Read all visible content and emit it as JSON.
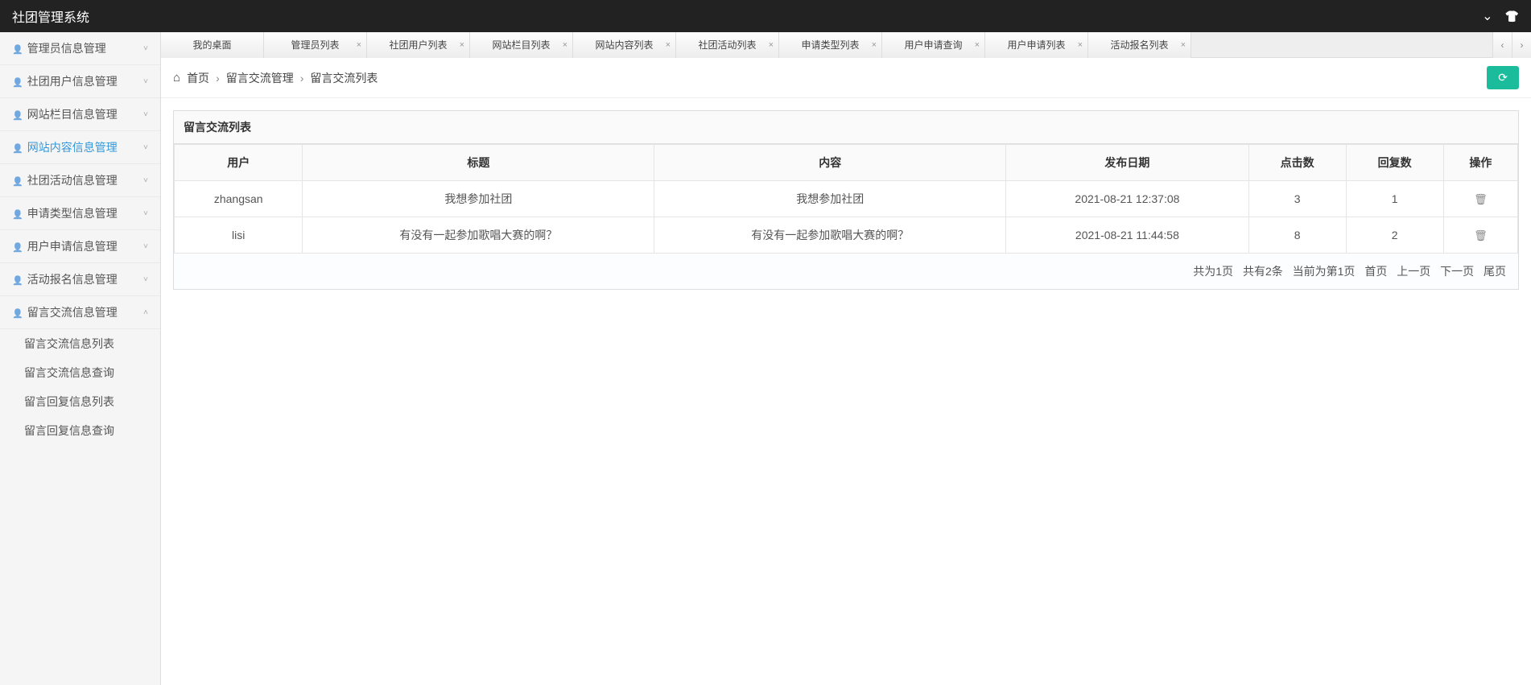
{
  "app_title": "社团管理系统",
  "sidebar": {
    "items": [
      {
        "label": "管理员信息管理",
        "expanded": false,
        "active": false
      },
      {
        "label": "社团用户信息管理",
        "expanded": false,
        "active": false
      },
      {
        "label": "网站栏目信息管理",
        "expanded": false,
        "active": false
      },
      {
        "label": "网站内容信息管理",
        "expanded": false,
        "active": true
      },
      {
        "label": "社团活动信息管理",
        "expanded": false,
        "active": false
      },
      {
        "label": "申请类型信息管理",
        "expanded": false,
        "active": false
      },
      {
        "label": "用户申请信息管理",
        "expanded": false,
        "active": false
      },
      {
        "label": "活动报名信息管理",
        "expanded": false,
        "active": false
      },
      {
        "label": "留言交流信息管理",
        "expanded": true,
        "active": false
      }
    ],
    "sub_items": [
      "留言交流信息列表",
      "留言交流信息查询",
      "留言回复信息列表",
      "留言回复信息查询"
    ]
  },
  "tabs": [
    "我的桌面",
    "管理员列表",
    "社团用户列表",
    "网站栏目列表",
    "网站内容列表",
    "社团活动列表",
    "申请类型列表",
    "用户申请查询",
    "用户申请列表",
    "活动报名列表"
  ],
  "breadcrumb": {
    "home": "首页",
    "group": "留言交流管理",
    "page": "留言交流列表"
  },
  "panel": {
    "title": "留言交流列表",
    "columns": [
      "用户",
      "标题",
      "内容",
      "发布日期",
      "点击数",
      "回复数",
      "操作"
    ],
    "rows": [
      {
        "user": "zhangsan",
        "title": "我想参加社团",
        "content": "我想参加社团",
        "date": "2021-08-21 12:37:08",
        "clicks": "3",
        "replies": "1"
      },
      {
        "user": "lisi",
        "title": "有没有一起参加歌唱大赛的啊？",
        "content": "有没有一起参加歌唱大赛的啊？",
        "date": "2021-08-21 11:44:58",
        "clicks": "8",
        "replies": "2"
      }
    ]
  },
  "pagination": {
    "total_pages": "共为1页",
    "total_rows": "共有2条",
    "current": "当前为第1页",
    "first": "首页",
    "prev": "上一页",
    "next": "下一页",
    "last": "尾页"
  }
}
